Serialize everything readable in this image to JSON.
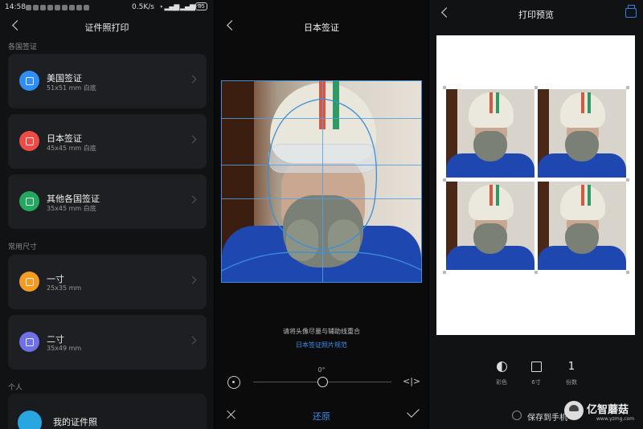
{
  "status": {
    "time": "14:58",
    "network": "0.5K/s",
    "battery": "85"
  },
  "left": {
    "title": "证件照打印",
    "section_visa": "各国签证",
    "section_size": "常用尺寸",
    "section_personal": "个人",
    "cards": [
      {
        "name": "美国签证",
        "spec": "51x51 mm 白底",
        "color": "#2f8ef5"
      },
      {
        "name": "日本签证",
        "spec": "45x45 mm 白底",
        "color": "#ee4b46"
      },
      {
        "name": "其他各国签证",
        "spec": "35x45 mm 白底",
        "color": "#22a861"
      },
      {
        "name": "一寸",
        "spec": "25x35 mm",
        "color": "#f59a23"
      },
      {
        "name": "二寸",
        "spec": "35x49 mm",
        "color": "#6f6fe6"
      }
    ],
    "my_photos": "我的证件照",
    "my_photos_color": "#27a6e0"
  },
  "middle": {
    "title": "日本签证",
    "hint": "请将头像尽量与辅助线重合",
    "spec_link": "日本签证照片规范",
    "angle": "0°",
    "reset": "还原",
    "accent": "#3b8ff0"
  },
  "right": {
    "title": "打印预览",
    "options": [
      {
        "label": "彩色",
        "icon": "color-icon"
      },
      {
        "label": "6寸",
        "icon": "paper-size-icon"
      },
      {
        "label": "份数",
        "value": "1"
      }
    ],
    "save": "保存到手机",
    "watermark": {
      "name": "亿智蘑菇",
      "url": "www.yzmg.com"
    }
  }
}
